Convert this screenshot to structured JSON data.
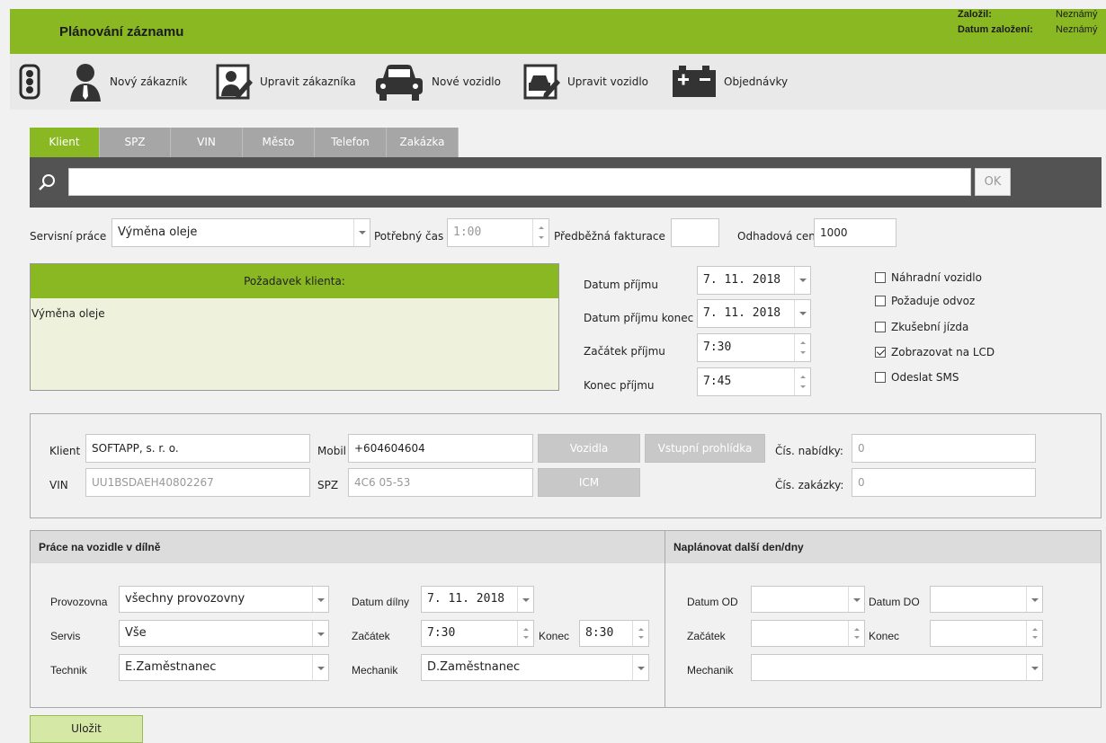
{
  "header": {
    "title": "Plánování záznamu",
    "created_by_label": "Založil:",
    "created_by_value": "Neznámý",
    "created_date_label": "Datum založení:",
    "created_date_value": "Neznámý"
  },
  "toolbar": {
    "new_customer": "Nový zákazník",
    "edit_customer": "Upravit zákazníka",
    "new_vehicle": "Nové vozidlo",
    "edit_vehicle": "Upravit vozidlo",
    "orders": "Objednávky"
  },
  "tabs": [
    "Klient",
    "SPZ",
    "VIN",
    "Město",
    "Telefon",
    "Zakázka"
  ],
  "search": {
    "value": "",
    "ok_label": "OK"
  },
  "service": {
    "label": "Servisní práce",
    "value": "Výměna oleje",
    "time_label": "Potřebný čas",
    "time_value": "1:00",
    "invoice_label": "Předběžná fakturace",
    "invoice_value": "",
    "price_label": "Odhadová cena",
    "price_value": "1000"
  },
  "request": {
    "header": "Požadavek klienta:",
    "text": "Výměna oleje"
  },
  "intake": {
    "date_label": "Datum příjmu",
    "date_value": "7. 11. 2018",
    "date_end_label": "Datum příjmu konec",
    "date_end_value": "7. 11. 2018",
    "start_label": "Začátek příjmu",
    "start_value": "7:30",
    "end_label": "Konec příjmu",
    "end_value": "7:45"
  },
  "checkboxes": [
    {
      "label": "Náhradní vozidlo",
      "checked": false
    },
    {
      "label": "Požaduje odvoz",
      "checked": false
    },
    {
      "label": "Zkušební jízda",
      "checked": false
    },
    {
      "label": "Zobrazovat na LCD",
      "checked": true
    },
    {
      "label": "Odeslat SMS",
      "checked": false
    }
  ],
  "client": {
    "client_label": "Klient",
    "client_value": "SOFTAPP, s. r. o.",
    "mobile_label": "Mobil",
    "mobile_value": "+604604604",
    "vin_label": "VIN",
    "vin_value": "UU1BSDAEH40802267",
    "spz_label": "SPZ",
    "spz_value": "4C6 05-53",
    "vehicles_btn": "Vozidla",
    "inspection_btn": "Vstupní prohlídka",
    "icm_btn": "ICM",
    "offer_label": "Čís. nabídky:",
    "offer_value": "0",
    "order_label": "Čís. zakázky:",
    "order_value": "0"
  },
  "workshop": {
    "header": "Práce na vozidle v dílně",
    "branch_label": "Provozovna",
    "branch_value": "všechny provozovny",
    "service_label": "Servis",
    "service_value": "Vše",
    "technician_label": "Technik",
    "technician_value": "E.Zaměstnanec",
    "date_label": "Datum dílny",
    "date_value": "7. 11. 2018",
    "start_label": "Začátek",
    "start_value": "7:30",
    "end_label": "Konec",
    "end_value": "8:30",
    "mechanic_label": "Mechanik",
    "mechanic_value": "D.Zaměstnanec"
  },
  "next_days": {
    "header": "Naplánovat další den/dny",
    "from_label": "Datum OD",
    "from_value": "",
    "to_label": "Datum DO",
    "to_value": "",
    "start_label": "Začátek",
    "start_value": "",
    "end_label": "Konec",
    "end_value": "",
    "mechanic_label": "Mechanik",
    "mechanic_value": ""
  },
  "save_label": "Uložit"
}
